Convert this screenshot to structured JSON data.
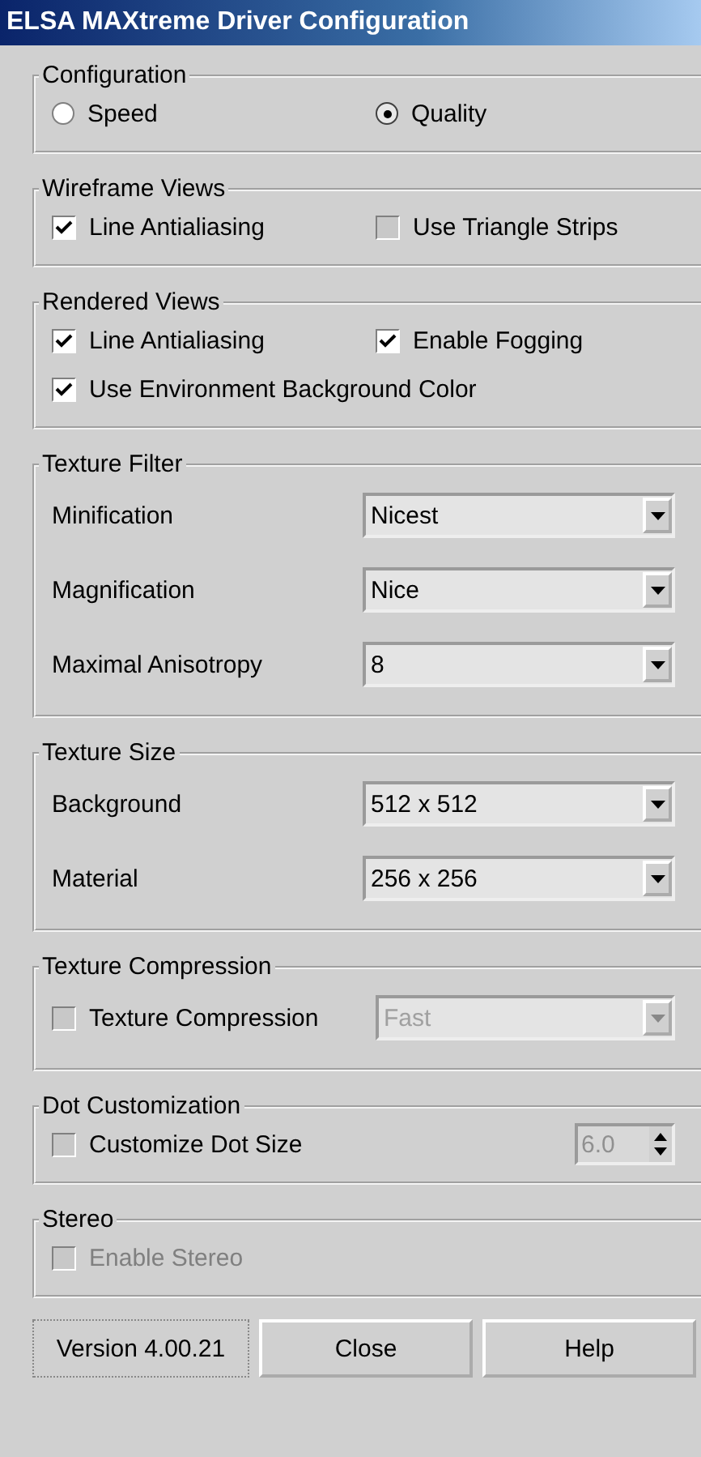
{
  "window": {
    "title": "ELSA MAXtreme Driver Configuration"
  },
  "groups": [
    {
      "title": "Configuration",
      "rows": [
        [
          {
            "kind": "radio",
            "label": "Speed",
            "selected": false
          },
          {
            "kind": "radio",
            "label": "Quality",
            "selected": true
          }
        ]
      ]
    },
    {
      "title": "Wireframe Views",
      "rows": [
        [
          {
            "kind": "checkbox",
            "label": "Line Antialiasing",
            "checked": true,
            "disabled": false
          },
          {
            "kind": "checkbox",
            "label": "Use Triangle Strips",
            "checked": false,
            "disabled": false
          }
        ]
      ]
    },
    {
      "title": "Rendered Views",
      "rows": [
        [
          {
            "kind": "checkbox",
            "label": "Line Antialiasing",
            "checked": true,
            "disabled": false
          },
          {
            "kind": "checkbox",
            "label": "Enable Fogging",
            "checked": true,
            "disabled": false
          }
        ],
        [
          {
            "kind": "checkbox",
            "label": "Use Environment Background Color",
            "checked": true,
            "disabled": false
          }
        ]
      ]
    },
    {
      "title": "Texture Filter",
      "rows": [
        [
          {
            "kind": "label",
            "label": "Minification"
          },
          {
            "kind": "select",
            "value": "Nicest",
            "disabled": false
          }
        ],
        [
          {
            "kind": "label",
            "label": "Magnification"
          },
          {
            "kind": "select",
            "value": "Nice",
            "disabled": false
          }
        ],
        [
          {
            "kind": "label",
            "label": "Maximal Anisotropy"
          },
          {
            "kind": "select",
            "value": "8",
            "disabled": false
          }
        ]
      ]
    },
    {
      "title": "Texture Size",
      "rows": [
        [
          {
            "kind": "label",
            "label": "Background"
          },
          {
            "kind": "select",
            "value": "512 x 512",
            "disabled": false
          }
        ],
        [
          {
            "kind": "label",
            "label": "Material"
          },
          {
            "kind": "select",
            "value": "256 x 256",
            "disabled": false
          }
        ]
      ]
    },
    {
      "title": "Texture Compression",
      "rows": [
        [
          {
            "kind": "checkbox",
            "label": "Texture Compression",
            "checked": false,
            "disabled": false
          },
          {
            "kind": "select",
            "value": "Fast",
            "disabled": true
          }
        ]
      ]
    },
    {
      "title": "Dot Customization",
      "rows": [
        [
          {
            "kind": "checkbox",
            "label": "Customize Dot Size",
            "checked": false,
            "disabled": false
          },
          {
            "kind": "spin",
            "value": "6.0",
            "disabled": true
          }
        ]
      ]
    },
    {
      "title": "Stereo",
      "rows": [
        [
          {
            "kind": "checkbox",
            "label": "Enable Stereo",
            "checked": false,
            "disabled": true
          }
        ]
      ]
    }
  ],
  "footer": {
    "version": "Version 4.00.21",
    "buttons": [
      "Close",
      "Help"
    ]
  }
}
